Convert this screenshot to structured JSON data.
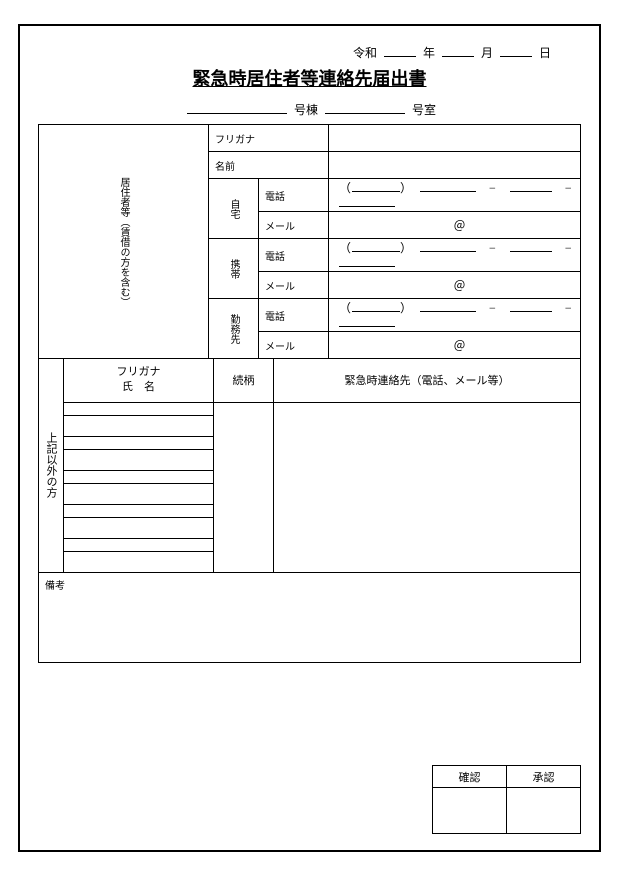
{
  "date": {
    "era": "令和",
    "year": "年",
    "month": "月",
    "day": "日"
  },
  "title": "緊急時居住者等連絡先届出書",
  "unit": {
    "building": "号棟",
    "room": "号室"
  },
  "resident": {
    "side_label": "居住者等（賃借の方を含む）",
    "furigana_label": "フリガナ",
    "name_label": "名前",
    "home_label": "自宅",
    "mobile_label": "携帯",
    "work_label": "勤務先",
    "phone_label": "電話",
    "mail_label": "メール",
    "at": "＠"
  },
  "others": {
    "side_label": "上記以外の方",
    "col_furigana": "フリガナ",
    "col_name": "氏　名",
    "col_relation": "続柄",
    "col_contact": "緊急時連絡先（電話、メール等）"
  },
  "notes_label": "備考",
  "approval": {
    "check": "確認",
    "approve": "承認"
  }
}
